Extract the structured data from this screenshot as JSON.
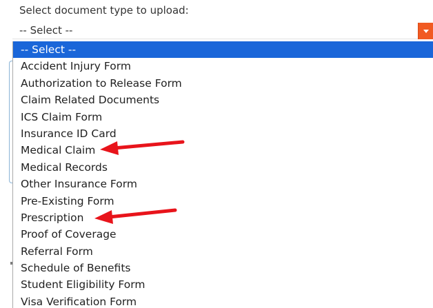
{
  "form": {
    "label": "Select document type to upload:",
    "select": {
      "current_value": "-- Select --",
      "toggle_icon": "chevron-down-icon",
      "accent": "#f15a22"
    }
  },
  "dropdown": {
    "highlight_color": "#1a66d9",
    "options": [
      {
        "label": "-- Select --"
      },
      {
        "label": "Accident Injury Form"
      },
      {
        "label": "Authorization to Release Form"
      },
      {
        "label": "Claim Related Documents"
      },
      {
        "label": "ICS Claim Form"
      },
      {
        "label": "Insurance ID Card"
      },
      {
        "label": "Medical Claim"
      },
      {
        "label": "Medical Records"
      },
      {
        "label": "Other Insurance Form"
      },
      {
        "label": "Pre-Existing Form"
      },
      {
        "label": "Prescription"
      },
      {
        "label": "Proof of Coverage"
      },
      {
        "label": "Referral Form"
      },
      {
        "label": "Schedule of Benefits"
      },
      {
        "label": "Student Eligibility Form"
      },
      {
        "label": "Visa Verification Form"
      }
    ]
  },
  "annotations": {
    "arrow_color": "#e8141b",
    "arrows": [
      {
        "points_to": "Medical Claim"
      },
      {
        "points_to": "Prescription"
      }
    ]
  }
}
